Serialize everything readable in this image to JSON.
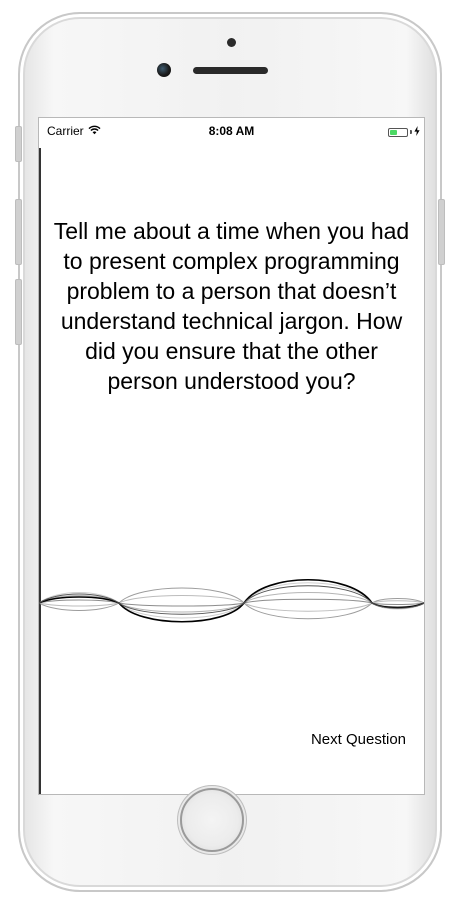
{
  "status_bar": {
    "carrier": "Carrier",
    "time": "8:08 AM",
    "wifi_icon": "wifi-icon",
    "battery_icon": "battery-icon",
    "charging_icon": "bolt-icon",
    "battery_level": 0.45,
    "battery_color": "#4cd964"
  },
  "question": {
    "text": "Tell me about a time when you had to present complex programming problem to a person that doesn’t understand technical jargon. How did you ensure that the other person understood you?"
  },
  "waveform": {
    "icon": "audio-waveform",
    "colors": [
      "#000000",
      "#8c8c8c",
      "#b5b5b5",
      "#cfcfcf"
    ]
  },
  "actions": {
    "next_label": "Next Question"
  }
}
